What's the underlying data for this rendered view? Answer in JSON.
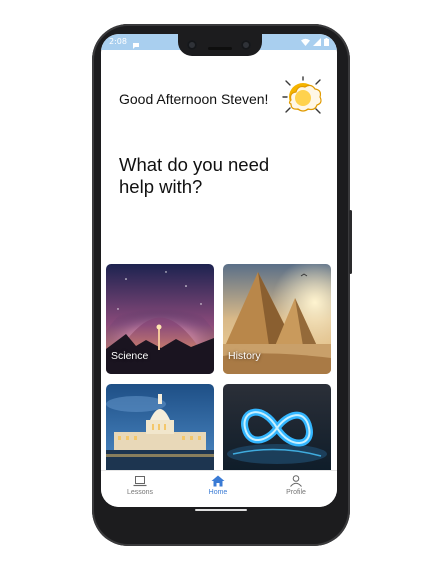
{
  "status_bar": {
    "time": "2:08",
    "background": "#a9cfef"
  },
  "header": {
    "greeting": "Good Afternoon Steven!",
    "weather_icon": "sun-cloud-icon"
  },
  "main": {
    "prompt": "What do you need help with?",
    "categories": [
      {
        "label": "Science"
      },
      {
        "label": "History"
      },
      {
        "label": ""
      },
      {
        "label": ""
      }
    ]
  },
  "bottom_nav": {
    "items": [
      {
        "label": "Lessons",
        "icon": "laptop-icon",
        "active": false
      },
      {
        "label": "Home",
        "icon": "home-icon",
        "active": true
      },
      {
        "label": "Profile",
        "icon": "person-icon",
        "active": false
      }
    ],
    "active_color": "#3a7bd5"
  }
}
